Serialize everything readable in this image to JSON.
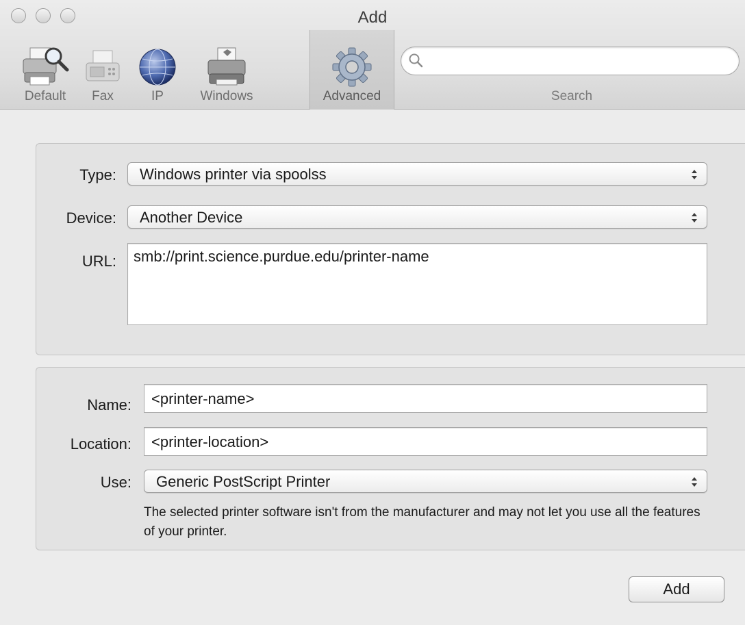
{
  "window": {
    "title": "Add"
  },
  "toolbar": {
    "items": [
      {
        "label": "Default",
        "icon": "default-printer-icon"
      },
      {
        "label": "Fax",
        "icon": "fax-icon"
      },
      {
        "label": "IP",
        "icon": "globe-icon"
      },
      {
        "label": "Windows",
        "icon": "windows-printer-icon"
      },
      {
        "label": "Advanced",
        "icon": "gear-icon",
        "selected": true
      }
    ],
    "search": {
      "label": "Search",
      "placeholder": ""
    }
  },
  "connection": {
    "type_label": "Type:",
    "type_value": "Windows printer via spoolss",
    "device_label": "Device:",
    "device_value": "Another Device",
    "url_label": "URL:",
    "url_value": "smb://print.science.purdue.edu/printer-name"
  },
  "printer": {
    "name_label": "Name:",
    "name_value": "<printer-name>",
    "location_label": "Location:",
    "location_value": "<printer-location>",
    "use_label": "Use:",
    "use_value": "Generic PostScript Printer",
    "note": "The selected printer software isn't from the manufacturer and may not let you use all the features of your printer."
  },
  "footer": {
    "add_label": "Add"
  },
  "colors": {
    "window_bg": "#ececec",
    "group_bg": "#e3e3e3",
    "selected_tool_bg": "#c8c8c8"
  }
}
